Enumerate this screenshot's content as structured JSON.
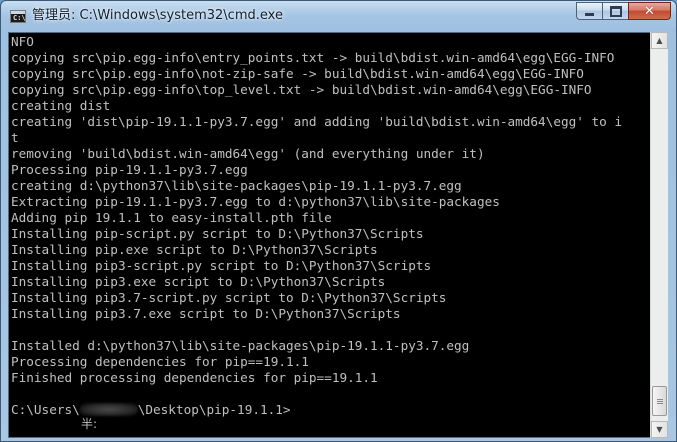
{
  "window": {
    "title": "管理员: C:\\Windows\\system32\\cmd.exe",
    "app_icon_text": "C:\\"
  },
  "controls": {
    "close_glyph": "✕"
  },
  "console": {
    "lines": [
      "NFO",
      "copying src\\pip.egg-info\\entry_points.txt -> build\\bdist.win-amd64\\egg\\EGG-INFO",
      "copying src\\pip.egg-info\\not-zip-safe -> build\\bdist.win-amd64\\egg\\EGG-INFO",
      "copying src\\pip.egg-info\\top_level.txt -> build\\bdist.win-amd64\\egg\\EGG-INFO",
      "creating dist",
      "creating 'dist\\pip-19.1.1-py3.7.egg' and adding 'build\\bdist.win-amd64\\egg' to i",
      "t",
      "removing 'build\\bdist.win-amd64\\egg' (and everything under it)",
      "Processing pip-19.1.1-py3.7.egg",
      "creating d:\\python37\\lib\\site-packages\\pip-19.1.1-py3.7.egg",
      "Extracting pip-19.1.1-py3.7.egg to d:\\python37\\lib\\site-packages",
      "Adding pip 19.1.1 to easy-install.pth file",
      "Installing pip-script.py script to D:\\Python37\\Scripts",
      "Installing pip.exe script to D:\\Python37\\Scripts",
      "Installing pip3-script.py script to D:\\Python37\\Scripts",
      "Installing pip3.exe script to D:\\Python37\\Scripts",
      "Installing pip3.7-script.py script to D:\\Python37\\Scripts",
      "Installing pip3.7.exe script to D:\\Python37\\Scripts",
      "",
      "Installed d:\\python37\\lib\\site-packages\\pip-19.1.1-py3.7.egg",
      "Processing dependencies for pip==19.1.1",
      "Finished processing dependencies for pip==19.1.1",
      ""
    ],
    "prompt_prefix": "C:\\Users\\",
    "prompt_suffix": "\\Desktop\\pip-19.1.1>",
    "ime_indicator": "半:"
  },
  "scrollbar": {
    "up_glyph": "▲",
    "down_glyph": "▼"
  },
  "colors": {
    "console_bg": "#000000",
    "console_fg": "#c0c0c0",
    "close_button": "#c04b32"
  }
}
